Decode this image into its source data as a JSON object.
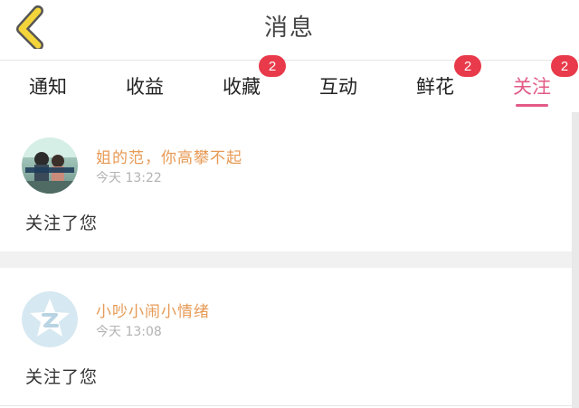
{
  "header": {
    "title": "消息",
    "back_icon": "chevron-left-icon",
    "accent": "#f3d43a"
  },
  "tabs": [
    {
      "label": "通知",
      "badge": "",
      "active": false
    },
    {
      "label": "收益",
      "badge": "",
      "active": false
    },
    {
      "label": "收藏",
      "badge": "2",
      "active": false
    },
    {
      "label": "互动",
      "badge": "",
      "active": false
    },
    {
      "label": "鲜花",
      "badge": "2",
      "active": false
    },
    {
      "label": "关注",
      "badge": "2",
      "active": true
    }
  ],
  "messages": [
    {
      "user": "姐的范，你高攀不起",
      "time": "今天 13:22",
      "content": "关注了您"
    },
    {
      "user": "小吵小闹小情绪",
      "time": "今天 13:08",
      "content": "关注了您"
    }
  ],
  "colors": {
    "active_tab": "#e25a86",
    "badge": "#e83a4a",
    "username": "#e79a55"
  }
}
